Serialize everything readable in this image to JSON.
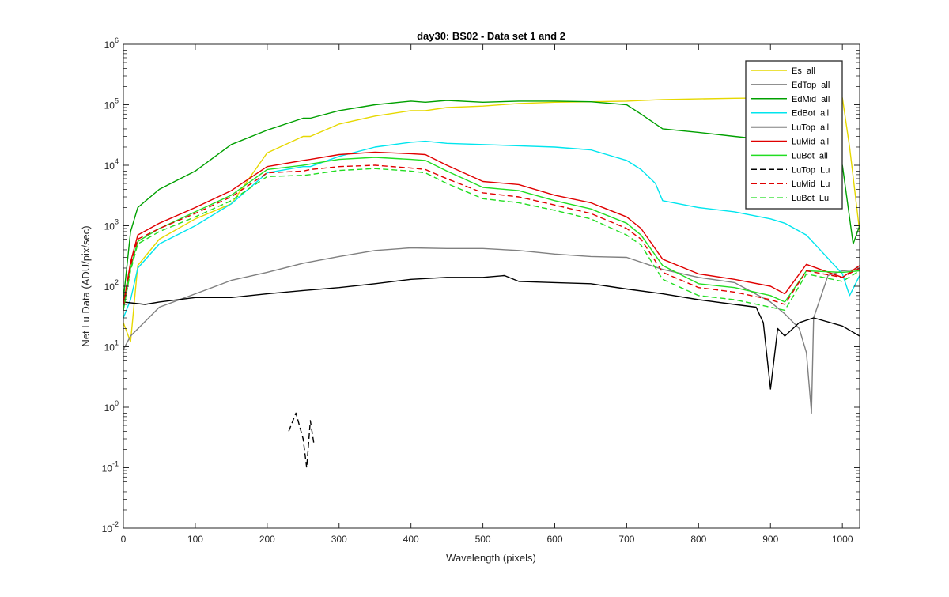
{
  "chart_data": {
    "type": "line",
    "title": "day30: BS02 - Data set 1 and 2",
    "xlabel": "Wavelength (pixels)",
    "ylabel": "Net Lu Data (ADU/pix/sec)",
    "xlim": [
      0,
      1024
    ],
    "ylim": [
      0.01,
      1000000
    ],
    "yscale": "log",
    "grid": false,
    "legend_position": "top-right",
    "x_ticks": [
      {
        "value": 0,
        "label": "0"
      },
      {
        "value": 100,
        "label": "100"
      },
      {
        "value": 200,
        "label": "200"
      },
      {
        "value": 300,
        "label": "300"
      },
      {
        "value": 400,
        "label": "400"
      },
      {
        "value": 500,
        "label": "500"
      },
      {
        "value": 600,
        "label": "600"
      },
      {
        "value": 700,
        "label": "700"
      },
      {
        "value": 800,
        "label": "800"
      },
      {
        "value": 900,
        "label": "900"
      },
      {
        "value": 1000,
        "label": "1000"
      }
    ],
    "y_ticks": [
      {
        "value": 0.01,
        "base": "10",
        "exp": "-2"
      },
      {
        "value": 0.1,
        "base": "10",
        "exp": "-1"
      },
      {
        "value": 1,
        "base": "10",
        "exp": "0"
      },
      {
        "value": 10,
        "base": "10",
        "exp": "1"
      },
      {
        "value": 100,
        "base": "10",
        "exp": "2"
      },
      {
        "value": 1000,
        "base": "10",
        "exp": "3"
      },
      {
        "value": 10000,
        "base": "10",
        "exp": "4"
      },
      {
        "value": 100000,
        "base": "10",
        "exp": "5"
      },
      {
        "value": 1000000,
        "base": "10",
        "exp": "6"
      }
    ],
    "series": [
      {
        "name": "Es  all",
        "color": "#e6d800",
        "dash": "solid",
        "x": [
          0,
          10,
          20,
          50,
          100,
          150,
          200,
          250,
          260,
          300,
          350,
          400,
          420,
          450,
          500,
          550,
          600,
          650,
          700,
          750,
          800,
          850,
          900,
          950,
          1000,
          1010,
          1024
        ],
        "y": [
          25,
          12,
          220,
          600,
          1300,
          2300,
          16000,
          30000,
          30000,
          48000,
          65000,
          80000,
          80000,
          90000,
          95000,
          105000,
          110000,
          112000,
          115000,
          122000,
          125000,
          128000,
          130000,
          132000,
          130000,
          20000,
          800
        ]
      },
      {
        "name": "EdTop  all",
        "color": "#808080",
        "dash": "solid",
        "x": [
          0,
          10,
          50,
          100,
          150,
          200,
          250,
          300,
          350,
          400,
          450,
          500,
          550,
          600,
          650,
          700,
          750,
          800,
          850,
          900,
          920,
          940,
          950,
          957,
          960,
          980,
          1000,
          1024
        ],
        "y": [
          9,
          15,
          45,
          75,
          125,
          170,
          240,
          310,
          390,
          430,
          420,
          420,
          390,
          340,
          310,
          300,
          190,
          140,
          115,
          55,
          35,
          20,
          8,
          0.8,
          30,
          150,
          180,
          190
        ]
      },
      {
        "name": "EdMid  all",
        "color": "#00a000",
        "dash": "solid",
        "x": [
          0,
          10,
          20,
          50,
          100,
          150,
          200,
          250,
          260,
          300,
          350,
          400,
          420,
          450,
          500,
          550,
          600,
          650,
          700,
          720,
          750,
          800,
          850,
          900,
          950,
          1000,
          1015,
          1024
        ],
        "y": [
          60,
          800,
          2000,
          4000,
          8000,
          22000,
          38000,
          60000,
          60000,
          80000,
          100000,
          115000,
          110000,
          118000,
          110000,
          115000,
          115000,
          112000,
          100000,
          70000,
          40000,
          35000,
          30000,
          26000,
          22000,
          10000,
          500,
          1000
        ]
      },
      {
        "name": "EdBot  all",
        "color": "#00e5ee",
        "dash": "solid",
        "x": [
          0,
          10,
          20,
          50,
          100,
          150,
          200,
          250,
          260,
          300,
          350,
          400,
          420,
          450,
          500,
          550,
          600,
          650,
          700,
          720,
          740,
          750,
          800,
          850,
          900,
          920,
          950,
          1000,
          1010,
          1024
        ],
        "y": [
          30,
          60,
          200,
          500,
          1000,
          2300,
          7500,
          9500,
          9500,
          14000,
          20000,
          24000,
          25000,
          23000,
          22000,
          21000,
          20000,
          18000,
          12000,
          8500,
          5000,
          2600,
          2000,
          1700,
          1300,
          1100,
          700,
          160,
          70,
          150
        ]
      },
      {
        "name": "LuTop  all",
        "color": "#000000",
        "dash": "solid",
        "x": [
          0,
          30,
          50,
          100,
          150,
          200,
          250,
          300,
          350,
          400,
          450,
          500,
          530,
          550,
          600,
          650,
          700,
          750,
          800,
          850,
          880,
          890,
          900,
          910,
          920,
          940,
          960,
          1000,
          1024
        ],
        "y": [
          55,
          50,
          55,
          65,
          65,
          75,
          85,
          95,
          110,
          130,
          140,
          140,
          150,
          120,
          115,
          110,
          90,
          75,
          60,
          50,
          45,
          25,
          2,
          20,
          15,
          25,
          30,
          22,
          15
        ]
      },
      {
        "name": "LuMid  all",
        "color": "#e00000",
        "dash": "solid",
        "x": [
          0,
          10,
          20,
          50,
          100,
          150,
          200,
          250,
          260,
          300,
          350,
          400,
          420,
          450,
          500,
          550,
          600,
          650,
          700,
          720,
          750,
          800,
          850,
          900,
          920,
          950,
          1000,
          1024
        ],
        "y": [
          50,
          250,
          700,
          1100,
          2000,
          3800,
          9500,
          12000,
          12500,
          15000,
          16500,
          15500,
          15000,
          10000,
          5400,
          4800,
          3200,
          2400,
          1400,
          900,
          280,
          160,
          130,
          100,
          75,
          230,
          140,
          220
        ]
      },
      {
        "name": "LuBot  all",
        "color": "#22dd22",
        "dash": "solid",
        "x": [
          0,
          10,
          20,
          50,
          100,
          150,
          200,
          250,
          260,
          300,
          350,
          400,
          420,
          450,
          500,
          550,
          600,
          650,
          700,
          720,
          750,
          800,
          850,
          900,
          920,
          950,
          1000,
          1024
        ],
        "y": [
          40,
          200,
          550,
          900,
          1700,
          3200,
          8500,
          10000,
          10500,
          12500,
          13500,
          12500,
          12000,
          8000,
          4300,
          3800,
          2600,
          1900,
          1100,
          700,
          220,
          110,
          95,
          70,
          55,
          180,
          170,
          180
        ]
      },
      {
        "name": "LuTop  Lu",
        "color": "#000000",
        "dash": "dashed",
        "x": [
          230,
          240,
          250,
          255,
          260,
          265
        ],
        "y": [
          0.4,
          0.8,
          0.3,
          0.1,
          0.6,
          0.25
        ]
      },
      {
        "name": "LuMid  Lu",
        "color": "#e00000",
        "dash": "dashed",
        "x": [
          0,
          10,
          20,
          50,
          100,
          150,
          200,
          250,
          260,
          300,
          350,
          400,
          420,
          450,
          500,
          550,
          600,
          650,
          700,
          720,
          750,
          800,
          850,
          900,
          920,
          950,
          1000,
          1024
        ],
        "y": [
          45,
          220,
          600,
          900,
          1600,
          3000,
          7500,
          8000,
          8500,
          9500,
          10000,
          9000,
          8500,
          6000,
          3500,
          3000,
          2200,
          1600,
          900,
          600,
          170,
          95,
          80,
          60,
          50,
          180,
          140,
          200
        ]
      },
      {
        "name": "LuBot  Lu",
        "color": "#22dd22",
        "dash": "dashed",
        "x": [
          0,
          10,
          20,
          50,
          100,
          150,
          200,
          250,
          260,
          300,
          350,
          400,
          420,
          450,
          500,
          550,
          600,
          650,
          700,
          720,
          750,
          800,
          850,
          900,
          920,
          950,
          1000,
          1024
        ],
        "y": [
          40,
          180,
          500,
          800,
          1400,
          2600,
          6500,
          6800,
          7000,
          8200,
          8800,
          8000,
          7500,
          5000,
          2800,
          2400,
          1800,
          1300,
          700,
          480,
          130,
          70,
          60,
          45,
          40,
          160,
          120,
          180
        ]
      }
    ]
  }
}
